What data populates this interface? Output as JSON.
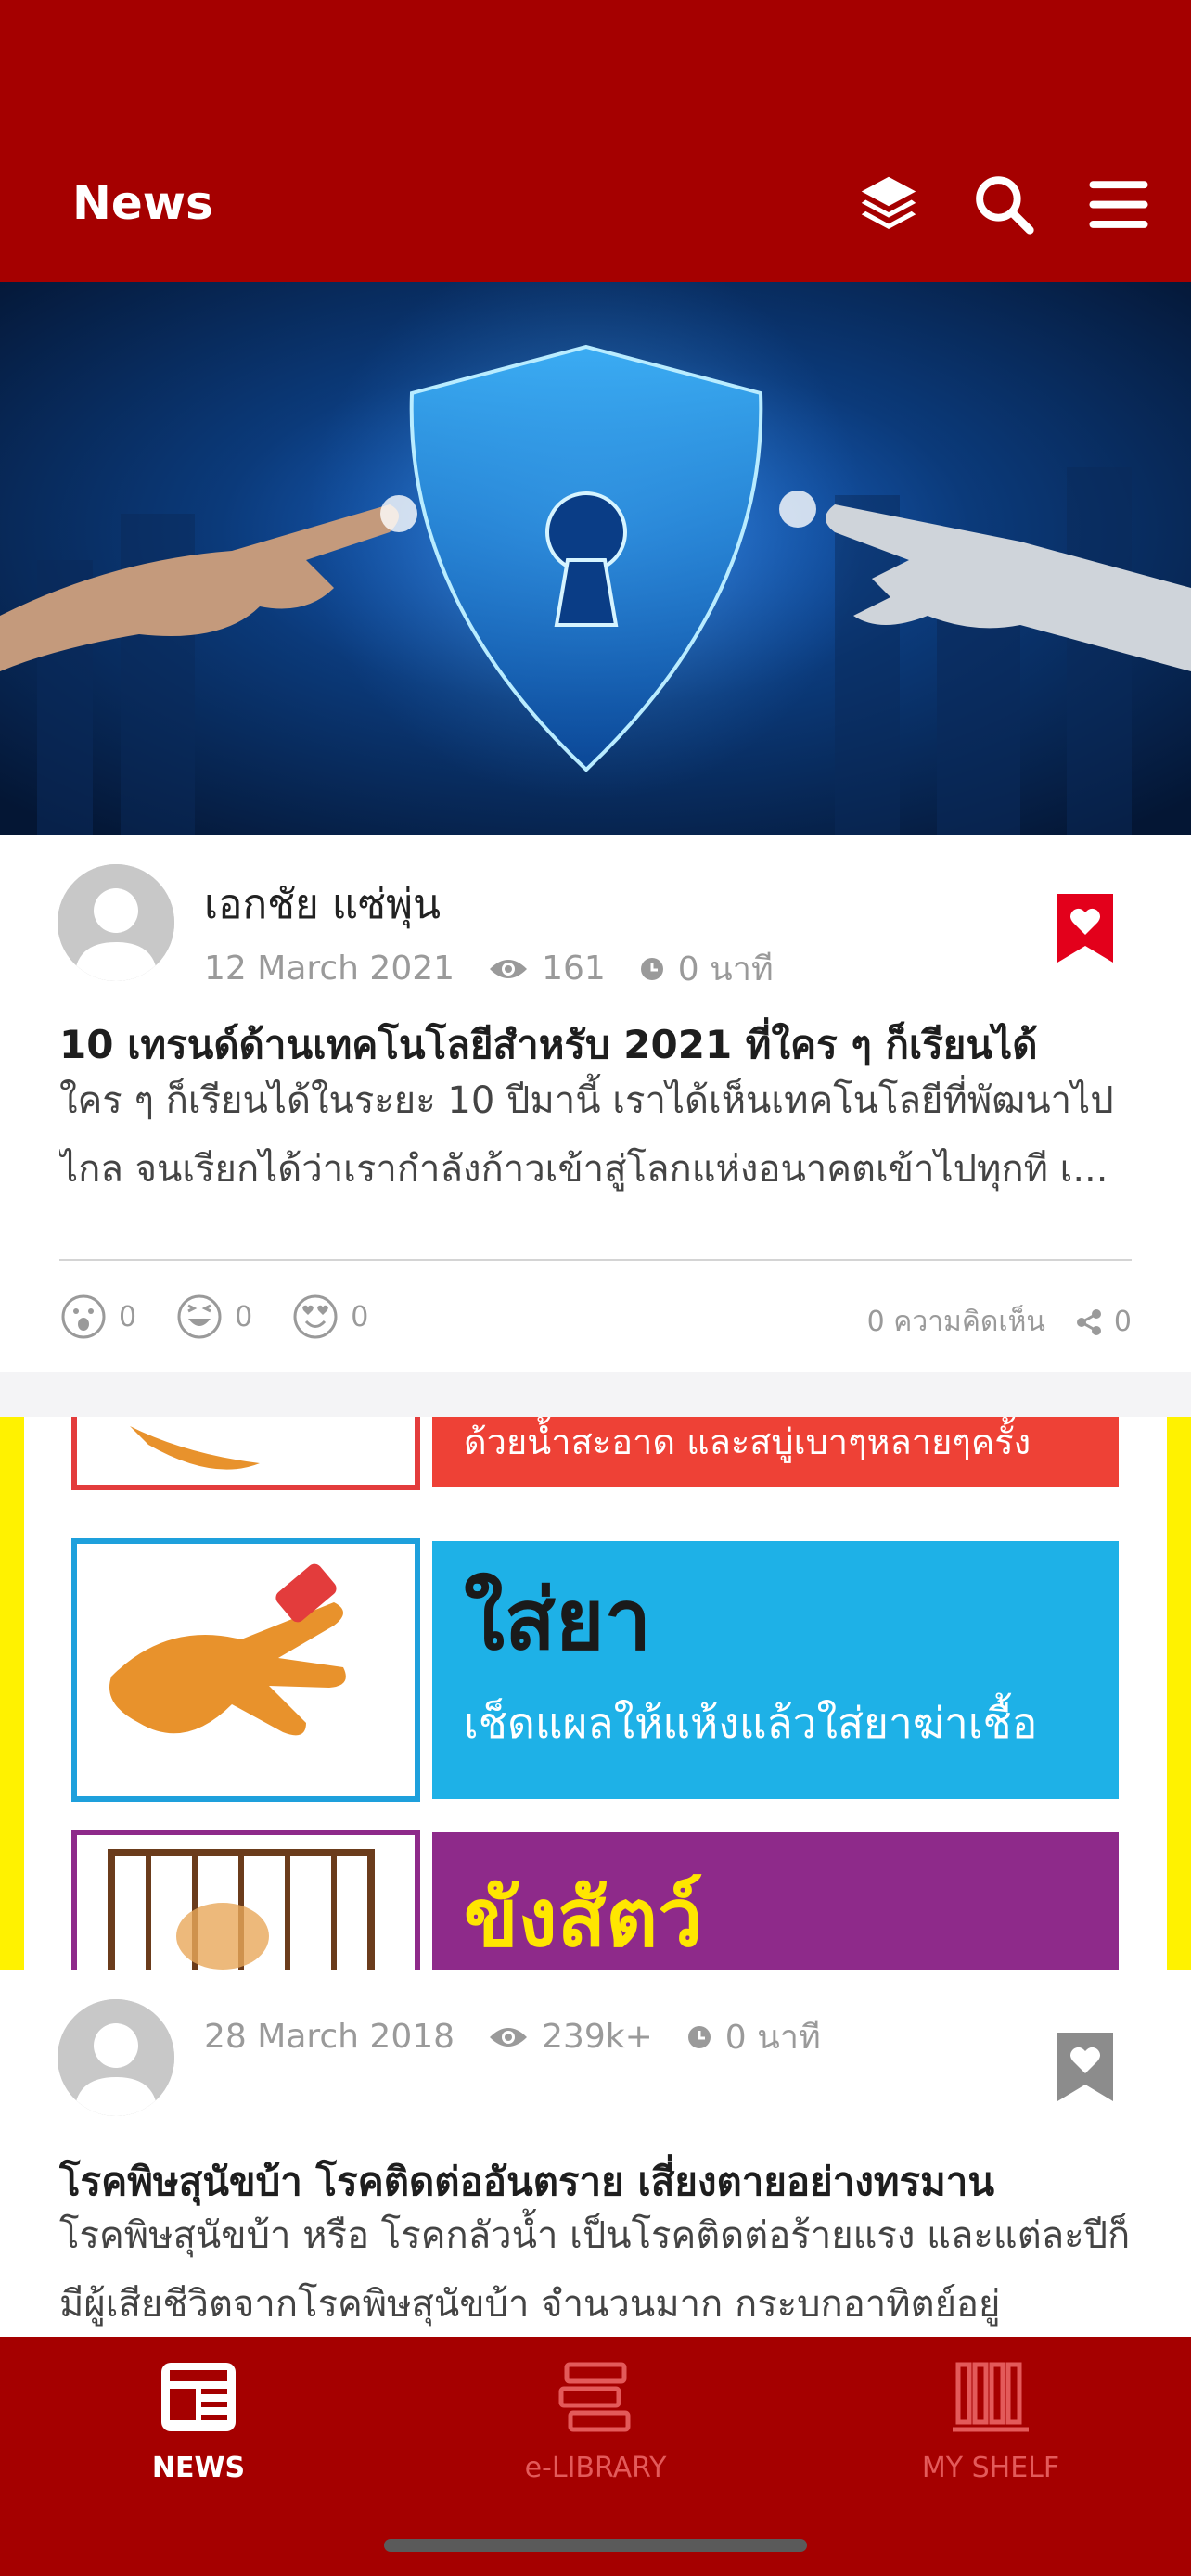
{
  "header": {
    "title": "News",
    "icons": [
      "layers-icon",
      "search-icon",
      "menu-icon"
    ],
    "background": "#a50000"
  },
  "articles": [
    {
      "image": "cyber-security-shield-hero",
      "author": "เอกชัย แซ่พุ่น",
      "date": "12 March 2021",
      "views": "161",
      "read_time": "0 นาที",
      "bookmarked": true,
      "title": "10 เทรนด์ด้านเทคโนโลยีสำหรับ 2021 ที่ใคร ๆ ก็เรียนได้",
      "excerpt": "ใคร ๆ ก็เรียนได้ในระยะ 10 ปีมานี้ เราได้เห็นเทคโนโลยีที่พัฒนาไปไกล จนเรียกได้ว่าเรากำลังก้าวเข้าสู่โลกแห่งอนาคตเข้าไปทุกที เ...",
      "reactions": [
        "0",
        "0",
        "0"
      ],
      "comments": "0 ความคิดเห็น",
      "shares": "0"
    },
    {
      "image": "rabies-first-aid-infographic",
      "image_text": {
        "top_strip": "ด้วยน้ำสะอาด และสบู่เบาๆหลายๆครั้ง",
        "step_title": "ใส่ยา",
        "step_desc": "เช็ดแผลให้แห้งแล้วใส่ยาฆ่าเชื้อ",
        "next_title": "ขังสัตว์"
      },
      "date": "28 March 2018",
      "views": "239k+",
      "read_time": "0 นาที",
      "bookmarked": false,
      "title": "โรคพิษสุนัขบ้า โรคติดต่ออันตราย เสี่ยงตายอย่างทรมาน",
      "excerpt": "โรคพิษสุนัขบ้า หรือ โรคกลัวน้ำ เป็นโรคติดต่อร้ายแรง และแต่ละปีก็มีผู้เสียชีวิตจากโรคพิษสุนัขบ้า จำนวนมาก กระบกอาทิตย์อยู่"
    }
  ],
  "bottom_nav": {
    "items": [
      {
        "label": "NEWS",
        "icon": "newspaper-icon",
        "active": true
      },
      {
        "label": "e-LIBRARY",
        "icon": "books-stack-icon",
        "active": false
      },
      {
        "label": "MY SHELF",
        "icon": "bookshelf-icon",
        "active": false
      }
    ]
  },
  "colors": {
    "brand": "#a50000",
    "bookmark_active": "#e3001b",
    "muted_text": "#9a9a9a"
  }
}
